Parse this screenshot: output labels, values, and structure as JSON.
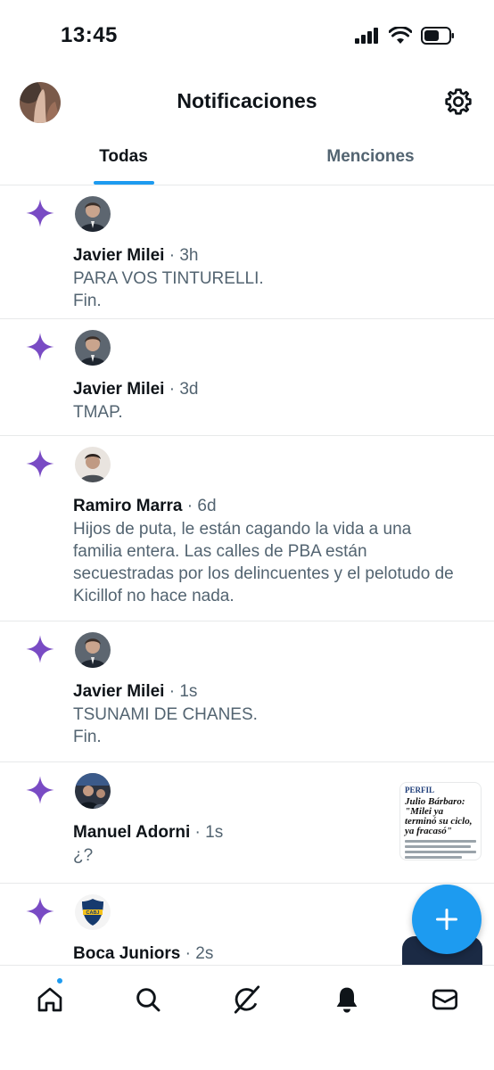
{
  "status_bar": {
    "time": "13:45"
  },
  "header": {
    "title": "Notificaciones"
  },
  "tabs": [
    {
      "label": "Todas"
    },
    {
      "label": "Menciones"
    }
  ],
  "notifications": [
    {
      "name": "Javier Milei",
      "meta": "· 3h",
      "lines": [
        "PARA VOS TINTURELLI.",
        "Fin."
      ]
    },
    {
      "name": "Javier Milei",
      "meta": "· 3d",
      "lines": [
        "TMAP."
      ]
    },
    {
      "name": "Ramiro Marra",
      "meta": "· 6d",
      "lines": [
        "Hijos de puta, le están cagando la vida a una",
        "familia entera. Las calles de PBA están",
        "secuestradas por los delincuentes y el pelotudo de",
        "Kicillof no hace nada."
      ]
    },
    {
      "name": "Javier Milei",
      "meta": "· 1s",
      "lines": [
        "TSUNAMI DE CHANES.",
        "Fin."
      ]
    },
    {
      "name": "Manuel Adorni",
      "meta": "· 1s",
      "lines": [
        "¿?"
      ],
      "thumbnail": {
        "logo": "PERFIL",
        "headline": "Julio Bárbaro: \"Milei ya terminó su ciclo, ya fracasó\""
      }
    },
    {
      "name": "Boca Juniors",
      "meta": "· 2s",
      "lines": [],
      "avatar_text": "CABJ"
    }
  ],
  "colors": {
    "accent": "#1d9bf0",
    "spark": "#794bc4",
    "text": "#0f1419",
    "muted": "#536471",
    "divider": "#e7e9ea"
  },
  "icons": {
    "spark": "sparkle-icon",
    "fab": "plus-icon",
    "nav": [
      "home-icon",
      "search-icon",
      "grok-icon",
      "bell-icon",
      "mail-icon"
    ]
  }
}
